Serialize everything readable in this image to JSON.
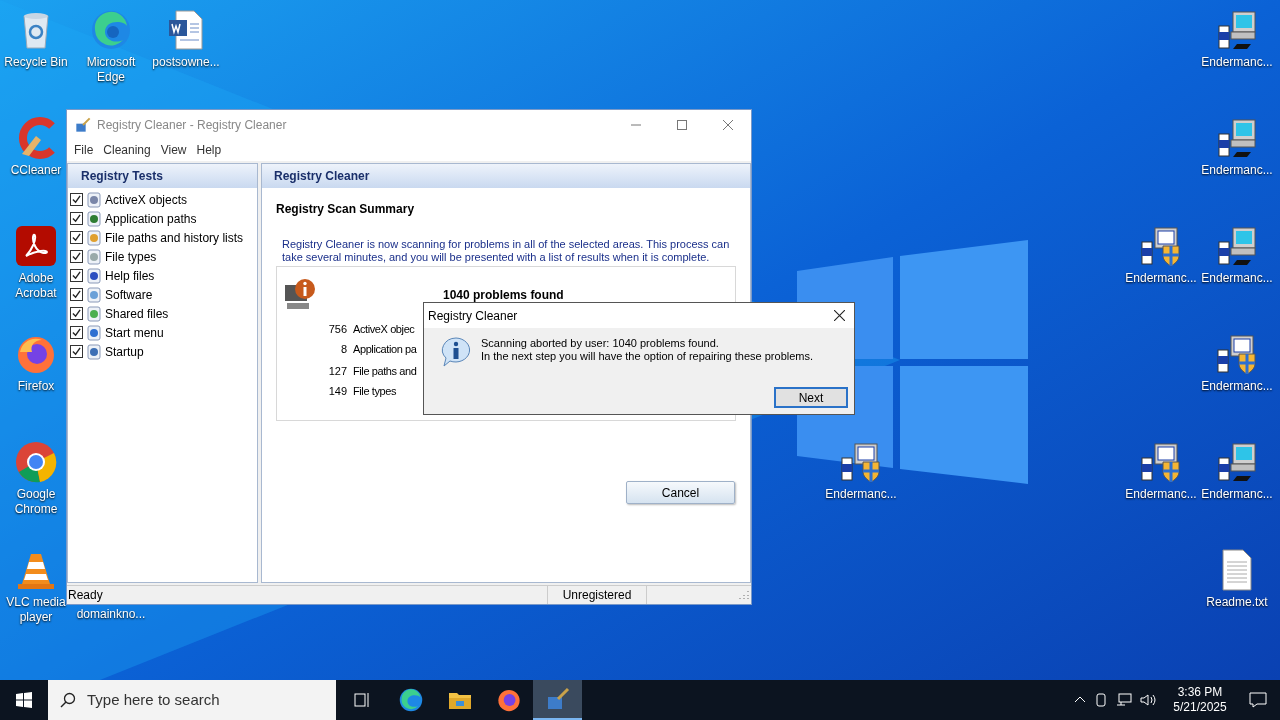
{
  "desktop_icons": [
    {
      "label": "Recycle Bin",
      "kind": "recycle"
    },
    {
      "label": "Microsoft Edge",
      "kind": "edge"
    },
    {
      "label": "postsowne...",
      "kind": "word"
    },
    {
      "label": "CCleaner",
      "kind": "ccleaner"
    },
    {
      "label": "Adobe Acrobat",
      "kind": "acrobat"
    },
    {
      "label": "Firefox",
      "kind": "firefox"
    },
    {
      "label": "Google Chrome",
      "kind": "chrome"
    },
    {
      "label": "VLC media player",
      "kind": "vlc"
    },
    {
      "label": "domainkno...",
      "kind": "hidden"
    },
    {
      "label": "Endermanc...",
      "kind": "installer"
    },
    {
      "label": "Endermanc...",
      "kind": "installer"
    },
    {
      "label": "Endermanc...",
      "kind": "shield"
    },
    {
      "label": "Endermanc...",
      "kind": "installer"
    },
    {
      "label": "Endermanc...",
      "kind": "shield"
    },
    {
      "label": "Endermanc...",
      "kind": "shield"
    },
    {
      "label": "Endermanc...",
      "kind": "shield"
    },
    {
      "label": "Endermanc...",
      "kind": "installer"
    },
    {
      "label": "Readme.txt",
      "kind": "text"
    }
  ],
  "window": {
    "title": "Registry Cleaner - Registry Cleaner",
    "menu": [
      "File",
      "Cleaning",
      "View",
      "Help"
    ],
    "tests_header": "Registry Tests",
    "tests": [
      {
        "label": "ActiveX objects",
        "checked": true
      },
      {
        "label": "Application paths",
        "checked": true
      },
      {
        "label": "File paths and history lists",
        "checked": true
      },
      {
        "label": "File types",
        "checked": true
      },
      {
        "label": "Help files",
        "checked": true
      },
      {
        "label": "Software",
        "checked": true
      },
      {
        "label": "Shared files",
        "checked": true
      },
      {
        "label": "Start menu",
        "checked": true
      },
      {
        "label": "Startup",
        "checked": true
      }
    ],
    "main_header": "Registry Cleaner",
    "summary_title": "Registry Scan Summary",
    "description": "Registry Cleaner is now scanning for problems in all of the selected areas. This process can take several minutes, and you will be presented with a list of results when it is complete.",
    "problems_title": "1040 problems found",
    "results": [
      {
        "count": "756",
        "label": "ActiveX objec"
      },
      {
        "count": "8",
        "label": "Application pa"
      },
      {
        "count": "127",
        "label": "File paths and"
      },
      {
        "count": "149",
        "label": "File types"
      }
    ],
    "cancel_button": "Cancel",
    "status": {
      "left": "Ready",
      "middle": "Unregistered"
    }
  },
  "dialog": {
    "title": "Registry Cleaner",
    "message": [
      "Scanning aborted by user: 1040 problems found.",
      "In the next step you will have the option of repairing these problems."
    ],
    "button": "Next"
  },
  "taskbar": {
    "search_placeholder": "Type here to search",
    "apps": [
      {
        "kind": "taskview",
        "selected": false
      },
      {
        "kind": "edge",
        "selected": false
      },
      {
        "kind": "folder",
        "selected": false
      },
      {
        "kind": "firefox",
        "selected": false
      },
      {
        "kind": "cleaner",
        "selected": true
      }
    ],
    "time": "3:36 PM",
    "date": "5/21/2025"
  }
}
